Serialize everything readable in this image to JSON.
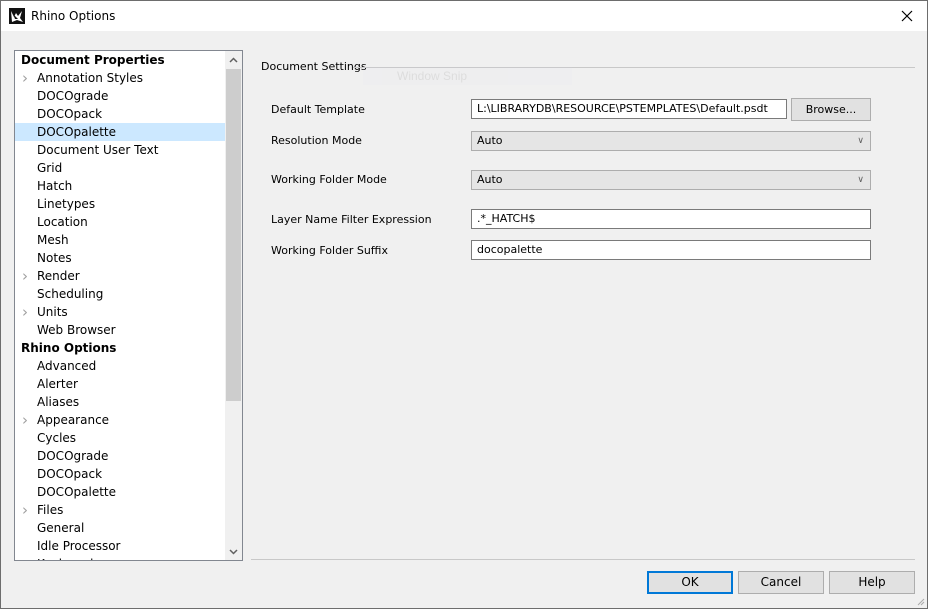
{
  "window": {
    "title": "Rhino Options",
    "icon": "rhino-logo-icon",
    "close_icon": "close-icon"
  },
  "tree": {
    "items": [
      {
        "label": "Document Properties",
        "type": "header"
      },
      {
        "label": "Annotation Styles",
        "type": "child",
        "expandable": true
      },
      {
        "label": "DOCOgrade",
        "type": "child"
      },
      {
        "label": "DOCOpack",
        "type": "child"
      },
      {
        "label": "DOCOpalette",
        "type": "child",
        "selected": true
      },
      {
        "label": "Document User Text",
        "type": "child"
      },
      {
        "label": "Grid",
        "type": "child"
      },
      {
        "label": "Hatch",
        "type": "child"
      },
      {
        "label": "Linetypes",
        "type": "child"
      },
      {
        "label": "Location",
        "type": "child"
      },
      {
        "label": "Mesh",
        "type": "child"
      },
      {
        "label": "Notes",
        "type": "child"
      },
      {
        "label": "Render",
        "type": "child",
        "expandable": true
      },
      {
        "label": "Scheduling",
        "type": "child"
      },
      {
        "label": "Units",
        "type": "child",
        "expandable": true
      },
      {
        "label": "Web Browser",
        "type": "child"
      },
      {
        "label": "Rhino Options",
        "type": "header"
      },
      {
        "label": "Advanced",
        "type": "child"
      },
      {
        "label": "Alerter",
        "type": "child"
      },
      {
        "label": "Aliases",
        "type": "child"
      },
      {
        "label": "Appearance",
        "type": "child",
        "expandable": true
      },
      {
        "label": "Cycles",
        "type": "child"
      },
      {
        "label": "DOCOgrade",
        "type": "child"
      },
      {
        "label": "DOCOpack",
        "type": "child"
      },
      {
        "label": "DOCOpalette",
        "type": "child"
      },
      {
        "label": "Files",
        "type": "child",
        "expandable": true
      },
      {
        "label": "General",
        "type": "child"
      },
      {
        "label": "Idle Processor",
        "type": "child"
      },
      {
        "label": "Keyboard",
        "type": "child"
      }
    ]
  },
  "settings": {
    "group_label": "Document Settings",
    "ghost_text": "Window Snip",
    "default_template": {
      "label": "Default Template",
      "value": "L:\\LIBRARYDB\\RESOURCE\\PSTEMPLATES\\Default.psdt",
      "browse_label": "Browse..."
    },
    "resolution_mode": {
      "label": "Resolution Mode",
      "value": "Auto"
    },
    "working_folder_mode": {
      "label": "Working Folder Mode",
      "value": "Auto"
    },
    "layer_filter": {
      "label": "Layer Name Filter Expression",
      "value": ".*_HATCH$"
    },
    "folder_suffix": {
      "label": "Working Folder Suffix",
      "value": "docopalette"
    }
  },
  "buttons": {
    "ok": "OK",
    "cancel": "Cancel",
    "help": "Help"
  }
}
